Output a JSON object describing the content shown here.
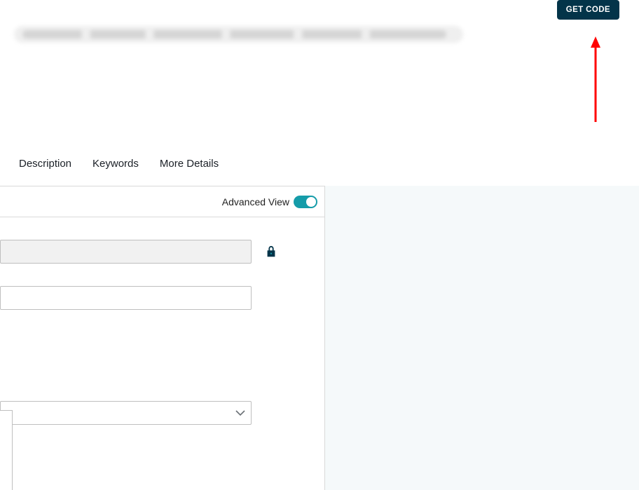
{
  "header": {
    "get_code_label": "GET CODE"
  },
  "tabs": {
    "description_label": "Description",
    "keywords_label": "Keywords",
    "more_details_label": "More Details"
  },
  "panel": {
    "advanced_view_label": "Advanced View",
    "advanced_view_on": true,
    "field1_value": "",
    "field2_value": "",
    "select1_value": ""
  }
}
